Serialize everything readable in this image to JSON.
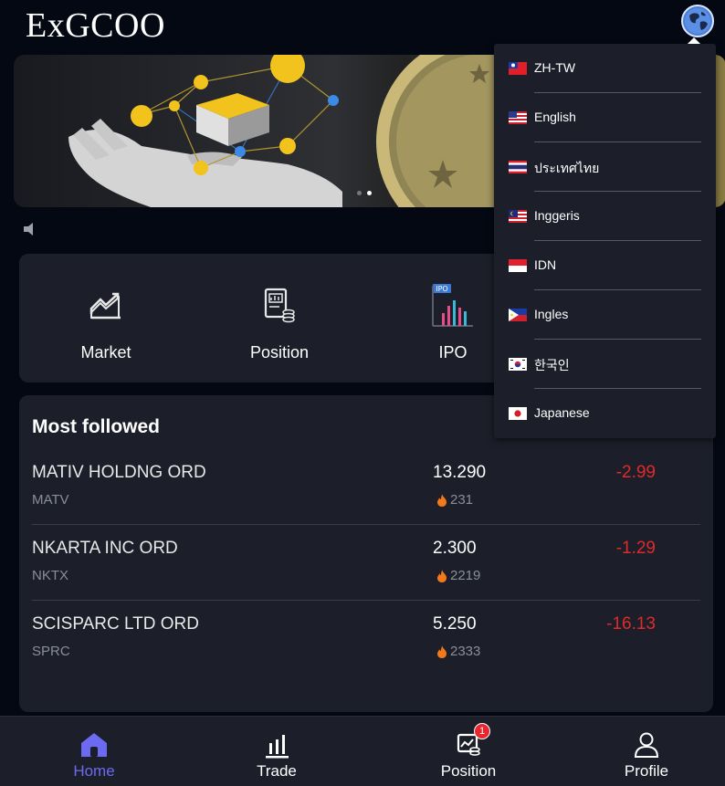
{
  "header": {
    "logo": "ExGCOO",
    "language_icon": "globe-icon"
  },
  "banner": {
    "slide_count": 2,
    "active_slide": 2
  },
  "quick_menu": [
    {
      "label": "Market",
      "icon": "market-chart-icon"
    },
    {
      "label": "Position",
      "icon": "position-doc-icon"
    },
    {
      "label": "IPO",
      "icon": "ipo-icon"
    }
  ],
  "most_followed": {
    "title": "Most followed",
    "stocks": [
      {
        "name": "MATIV HOLDNG ORD",
        "ticker": "MATV",
        "price": "13.290",
        "followers": "231",
        "change": "-2.99"
      },
      {
        "name": "NKARTA INC ORD",
        "ticker": "NKTX",
        "price": "2.300",
        "followers": "2219",
        "change": "-1.29"
      },
      {
        "name": "SCISPARC LTD ORD",
        "ticker": "SPRC",
        "price": "5.250",
        "followers": "2333",
        "change": "-16.13"
      }
    ]
  },
  "language_menu": [
    {
      "label": "ZH-TW",
      "flag": "taiwan-flag"
    },
    {
      "label": "English",
      "flag": "us-flag"
    },
    {
      "label": "ประเทศไทย",
      "flag": "thailand-flag"
    },
    {
      "label": "Inggeris",
      "flag": "malaysia-flag"
    },
    {
      "label": "IDN",
      "flag": "indonesia-flag"
    },
    {
      "label": "Ingles",
      "flag": "philippines-flag"
    },
    {
      "label": "한국인",
      "flag": "korea-flag"
    },
    {
      "label": "Japanese",
      "flag": "japan-flag"
    }
  ],
  "bottom_nav": {
    "items": [
      {
        "label": "Home",
        "icon": "home-icon",
        "active": true
      },
      {
        "label": "Trade",
        "icon": "trade-icon"
      },
      {
        "label": "Position",
        "icon": "position-icon",
        "badge": "1"
      },
      {
        "label": "Profile",
        "icon": "profile-icon"
      }
    ]
  },
  "colors": {
    "background": "#040812",
    "card": "#1c1f29",
    "accent": "#6d6af2",
    "negative": "#e02a2a",
    "fire": "#f27a1a"
  }
}
